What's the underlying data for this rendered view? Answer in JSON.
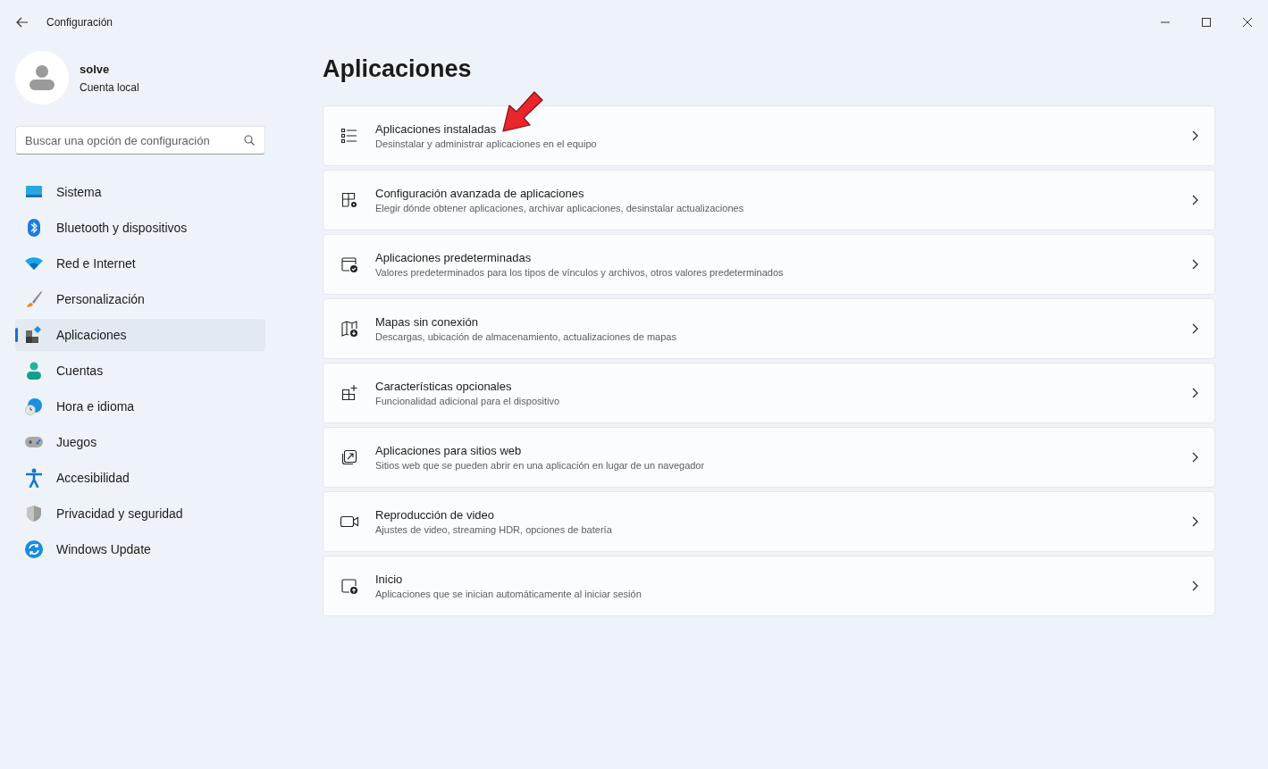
{
  "window": {
    "title": "Configuración"
  },
  "account": {
    "name": "solve",
    "type": "Cuenta local"
  },
  "search": {
    "placeholder": "Buscar una opción de configuración"
  },
  "sidebar": {
    "items": [
      {
        "label": "Sistema",
        "selected": false
      },
      {
        "label": "Bluetooth y dispositivos",
        "selected": false
      },
      {
        "label": "Red e Internet",
        "selected": false
      },
      {
        "label": "Personalización",
        "selected": false
      },
      {
        "label": "Aplicaciones",
        "selected": true
      },
      {
        "label": "Cuentas",
        "selected": false
      },
      {
        "label": "Hora e idioma",
        "selected": false
      },
      {
        "label": "Juegos",
        "selected": false
      },
      {
        "label": "Accesibilidad",
        "selected": false
      },
      {
        "label": "Privacidad y seguridad",
        "selected": false
      },
      {
        "label": "Windows Update",
        "selected": false
      }
    ]
  },
  "page": {
    "title": "Aplicaciones",
    "items": [
      {
        "title": "Aplicaciones instaladas",
        "description": "Desinstalar y administrar aplicaciones en el equipo"
      },
      {
        "title": "Configuración avanzada de aplicaciones",
        "description": "Elegir dónde obtener aplicaciones, archivar aplicaciones, desinstalar actualizaciones"
      },
      {
        "title": "Aplicaciones predeterminadas",
        "description": "Valores predeterminados para los tipos de vínculos y archivos, otros valores predeterminados"
      },
      {
        "title": "Mapas sin conexión",
        "description": "Descargas, ubicación de almacenamiento, actualizaciones de mapas"
      },
      {
        "title": "Características opcionales",
        "description": "Funcionalidad adicional para el dispositivo"
      },
      {
        "title": "Aplicaciones para sitios web",
        "description": "Sitios web que se pueden abrir en una aplicación en lugar de un navegador"
      },
      {
        "title": "Reproducción de video",
        "description": "Ajustes de video, streaming HDR, opciones de batería"
      },
      {
        "title": "Inicio",
        "description": "Aplicaciones que se inician automáticamente al iniciar sesión"
      }
    ]
  }
}
